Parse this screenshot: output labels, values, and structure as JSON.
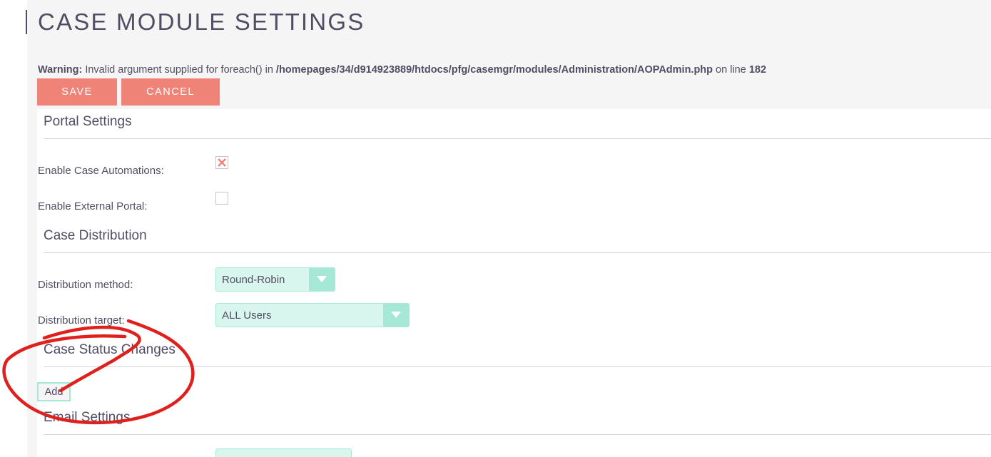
{
  "page": {
    "title": "CASE MODULE SETTINGS"
  },
  "warning": {
    "label": "Warning:",
    "message": " Invalid argument supplied for foreach() in ",
    "path": "/homepages/34/d914923889/htdocs/pfg/casemgr/modules/Administration/AOPAdmin.php",
    "line_text": " on line ",
    "line_number": "182"
  },
  "toolbar": {
    "save_label": "SAVE",
    "cancel_label": "CANCEL"
  },
  "portal_settings": {
    "title": "Portal Settings",
    "enable_case_automations_label": "Enable Case Automations:",
    "enable_case_automations_checked": true,
    "enable_external_portal_label": "Enable External Portal:",
    "enable_external_portal_checked": false
  },
  "case_distribution": {
    "title": "Case Distribution",
    "method_label": "Distribution method:",
    "method_value": "Round-Robin",
    "target_label": "Distribution target:",
    "target_value": "ALL Users"
  },
  "case_status_changes": {
    "title": "Case Status Changes",
    "add_label": "Add"
  },
  "email_settings": {
    "title": "Email Settings"
  },
  "colors": {
    "accent_button": "#f08377",
    "select_bg": "#d8f5ee",
    "select_arrow_bg": "#a5e8d6",
    "annotation": "#e0201c",
    "text": "#534d64"
  },
  "icons": {
    "checked": "x-mark-icon",
    "dropdown": "triangle-down-icon"
  }
}
